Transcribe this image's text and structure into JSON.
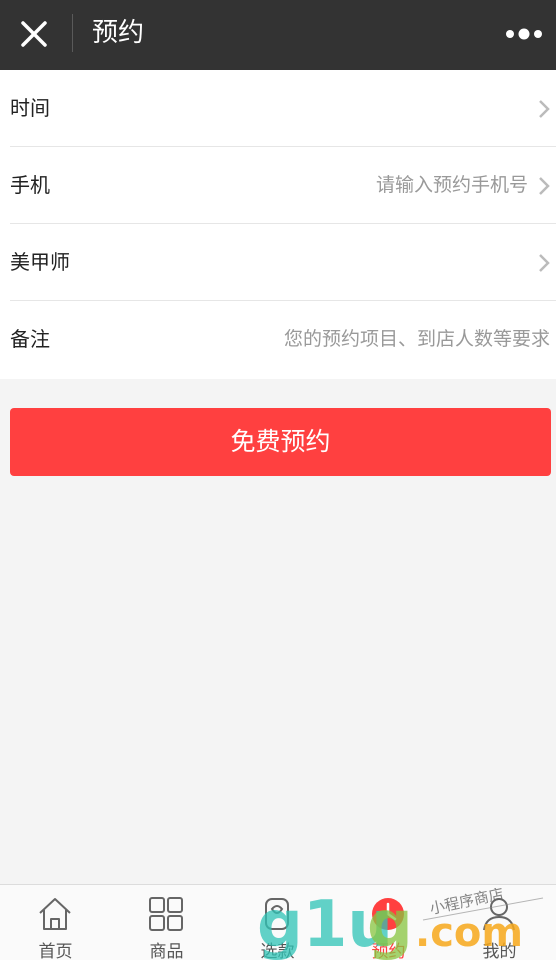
{
  "header": {
    "title": "预约"
  },
  "form": {
    "time": {
      "label": "时间",
      "value": ""
    },
    "phone": {
      "label": "手机",
      "placeholder": "请输入预约手机号"
    },
    "stylist": {
      "label": "美甲师",
      "value": ""
    },
    "note": {
      "label": "备注",
      "placeholder": "您的预约项目、到店人数等要求"
    }
  },
  "submit_label": "免费预约",
  "tabs": [
    {
      "label": "首页",
      "icon": "home-icon"
    },
    {
      "label": "商品",
      "icon": "grid-icon"
    },
    {
      "label": "选款",
      "icon": "style-icon"
    },
    {
      "label": "预约",
      "icon": "clock-icon",
      "active": true
    },
    {
      "label": "我的",
      "icon": "user-icon"
    }
  ],
  "watermark": {
    "brand": "g1ud.com",
    "tagline": "小程序商店"
  },
  "colors": {
    "accent": "#ff4040",
    "navbar": "#333333"
  }
}
